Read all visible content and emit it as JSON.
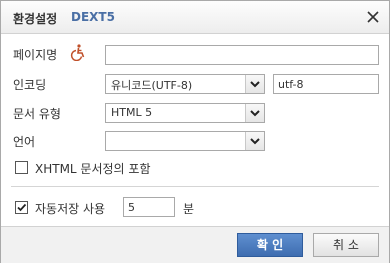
{
  "dialog": {
    "title": "환경설정",
    "product": "DEXT5",
    "close_glyph": "✕"
  },
  "page_name": {
    "label": "페이지명",
    "icon": "wheelchair-icon",
    "value": ""
  },
  "encoding": {
    "label": "인코딩",
    "selected": "유니코드(UTF-8)",
    "value": "utf-8"
  },
  "doc_type": {
    "label": "문서 유형",
    "selected": "HTML 5"
  },
  "language": {
    "label": "언어",
    "selected": ""
  },
  "xhtml": {
    "label": "XHTML 문서정의 포함",
    "checked": false
  },
  "autosave": {
    "label": "자동저장 사용",
    "checked": true,
    "value": "5",
    "unit": "분"
  },
  "buttons": {
    "ok": "확 인",
    "cancel": "취 소"
  },
  "colors": {
    "accent": "#3e6db0",
    "product": "#4a6fa5",
    "icon": "#c0502a"
  }
}
